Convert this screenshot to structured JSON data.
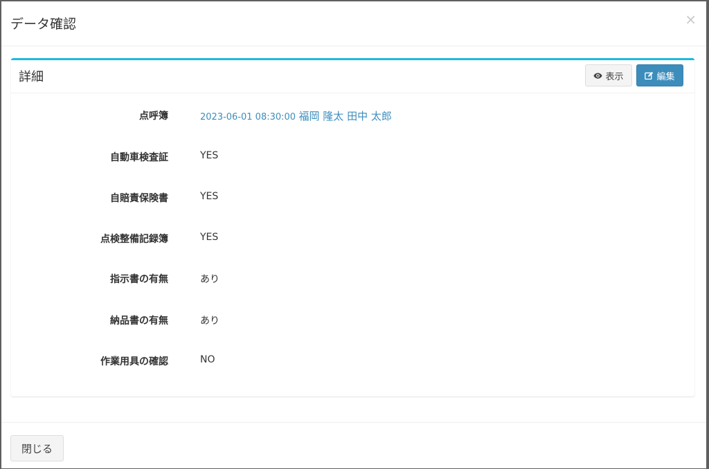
{
  "modal": {
    "title": "データ確認",
    "close_symbol": "×"
  },
  "box": {
    "title": "詳細",
    "view_button": {
      "label": "表示",
      "icon": "eye-icon"
    },
    "edit_button": {
      "label": "編集",
      "icon": "edit-icon"
    }
  },
  "details": [
    {
      "label": "点呼簿",
      "value_date": "2023-06-01 08:30:00",
      "value_name": "福岡 隆太 田中 太郎"
    },
    {
      "label": "自動車検査証",
      "value": "YES"
    },
    {
      "label": "自賠責保険書",
      "value": "YES"
    },
    {
      "label": "点検整備記録簿",
      "value": "YES"
    },
    {
      "label": "指示書の有無",
      "value": "あり"
    },
    {
      "label": "納品書の有無",
      "value": "あり"
    },
    {
      "label": "作業用具の確認",
      "value": "NO"
    }
  ],
  "footer": {
    "close_label": "閉じる"
  },
  "colors": {
    "accent": "#1cb8e0",
    "primary": "#3c8dbc",
    "backdrop": "#5f5f5f"
  }
}
